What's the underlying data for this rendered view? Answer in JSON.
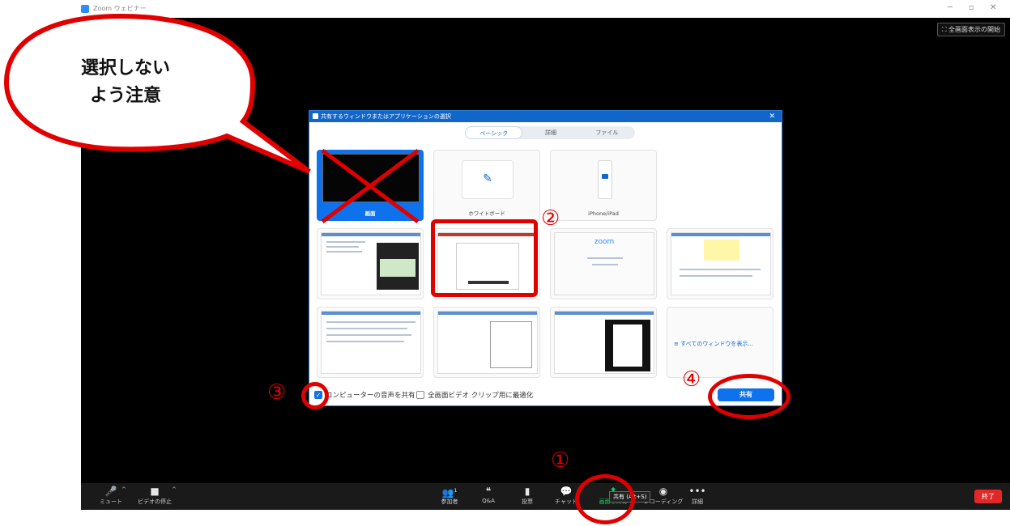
{
  "window": {
    "title": "Zoom ウェビナー",
    "minimize": "─",
    "restore": "▫",
    "close": "✕",
    "fullscreen": "全画面表示の開始"
  },
  "toolbar": {
    "items": [
      {
        "icon": "🎤",
        "label": "ミュート"
      },
      {
        "icon": "■",
        "label": "ビデオの停止"
      },
      {
        "icon": "👥",
        "label": "参加者"
      },
      {
        "icon": "❝",
        "label": "Q&A"
      },
      {
        "icon": "▮",
        "label": "投票"
      },
      {
        "icon": "💬",
        "label": "チャット"
      },
      {
        "icon": "⬆",
        "label": "画面を共有"
      },
      {
        "icon": "◉",
        "label": "レコーディング"
      },
      {
        "icon": "•••",
        "label": "詳細"
      }
    ],
    "participants_count": "1",
    "end_label": "終了",
    "tooltip": "共有 (Alt+S)",
    "caret": "^"
  },
  "dialog": {
    "title": "共有するウィンドウまたはアプリケーションの選択",
    "close": "✕",
    "tabs": [
      {
        "label": "ベーシック",
        "active": true
      },
      {
        "label": "詳細",
        "active": false
      },
      {
        "label": "ファイル",
        "active": false
      }
    ],
    "screen_label": "画面",
    "whiteboard_label": "ホワイトボード",
    "iphone_label": "iPhone/iPad",
    "all_windows": "すべてのウィンドウを表示...",
    "share_audio": "コンピューターの音声を共有",
    "optimize_video": "全画面ビデオ クリップ用に最適化",
    "share_button": "共有",
    "zoom_thumb_text": "zoom"
  },
  "annotations": {
    "callout_line1": "選択しない",
    "callout_line2": "よう注意",
    "n1": "①",
    "n2": "②",
    "n3": "③",
    "n4": "④"
  },
  "colors": {
    "accent": "#0e72ed",
    "share_green": "#1ecc5a",
    "annotation_red": "#e00000",
    "end_red": "#e02828"
  }
}
